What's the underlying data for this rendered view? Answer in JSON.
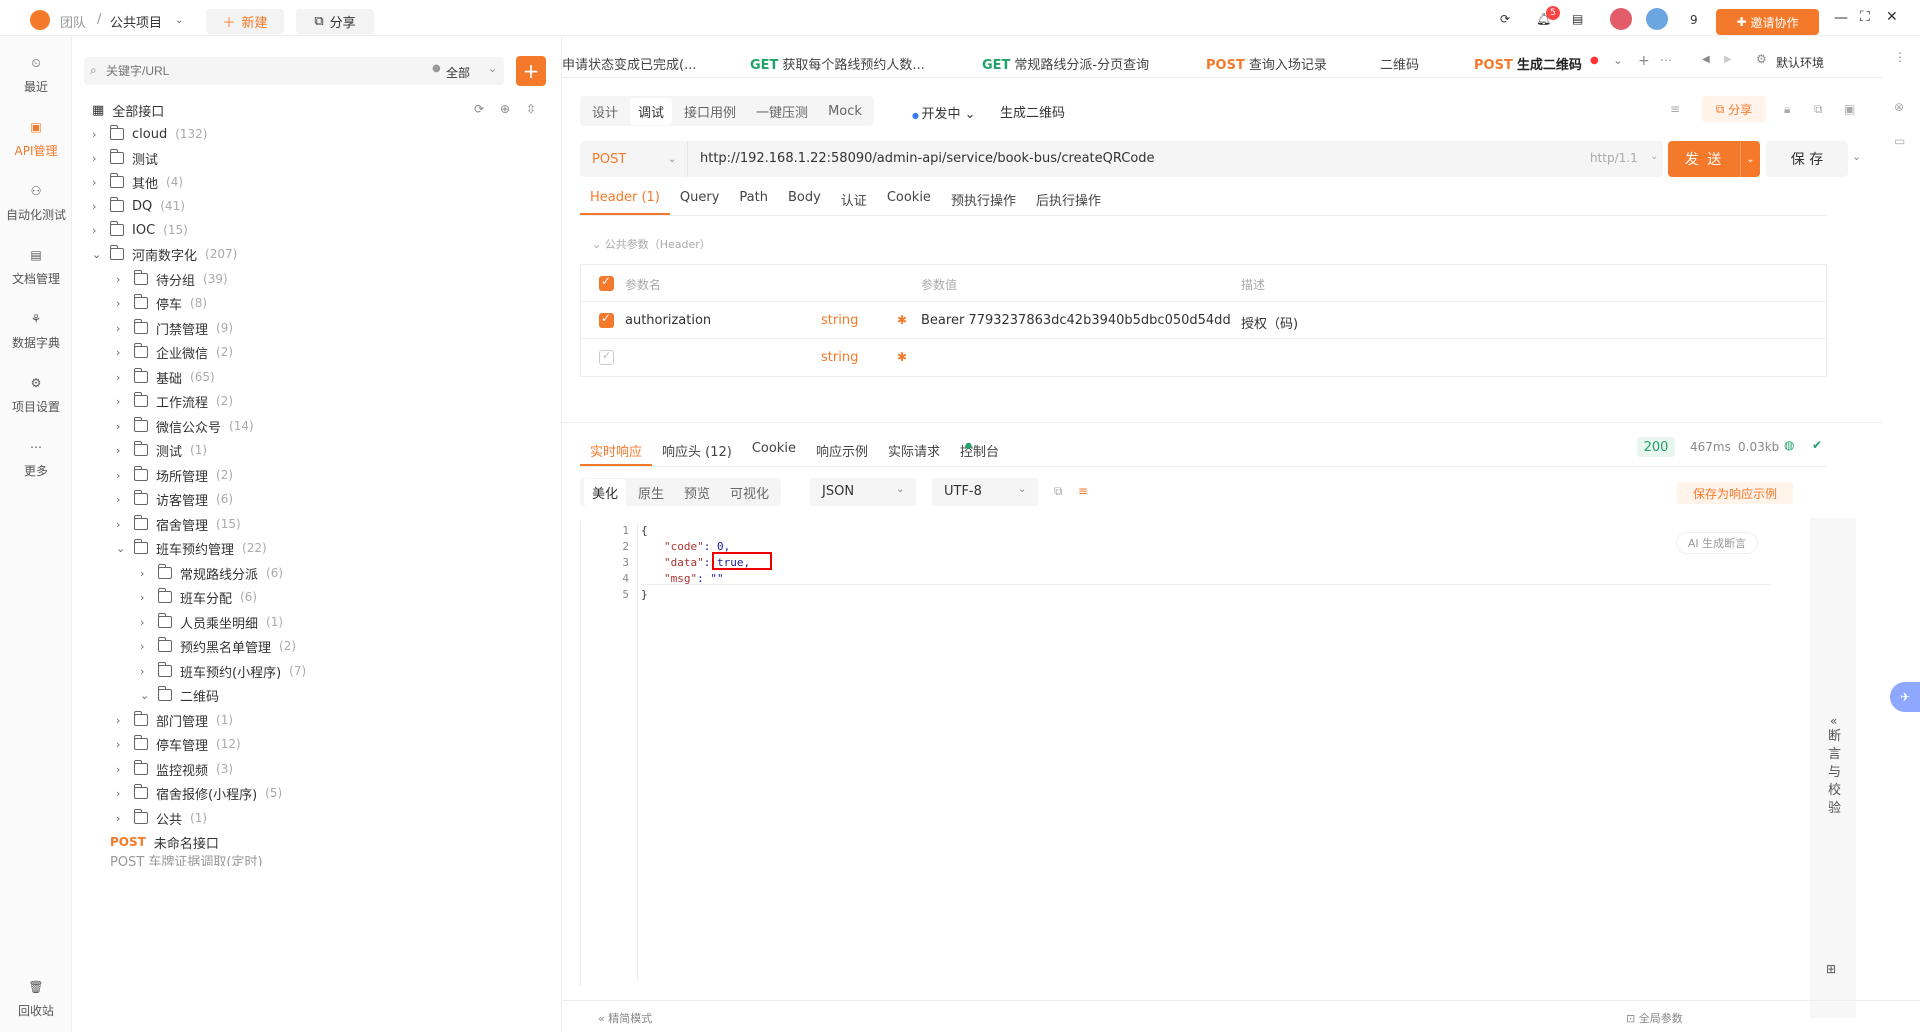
{
  "topbar": {
    "team": "团队",
    "sep": "/",
    "project": "公共项目",
    "new_label": "新建",
    "share_label": "分享",
    "notif_count": "5",
    "member_count": "9",
    "invite_label": "邀请协作"
  },
  "leftnav": {
    "items": [
      {
        "label": "最近"
      },
      {
        "label": "API管理"
      },
      {
        "label": "自动化测试"
      },
      {
        "label": "文档管理"
      },
      {
        "label": "数据字典"
      },
      {
        "label": "项目设置"
      },
      {
        "label": "更多"
      },
      {
        "label": "回收站"
      }
    ]
  },
  "tree": {
    "search_placeholder": "关键字/URL",
    "filter": "全部",
    "root": "全部接口",
    "nodes": [
      {
        "label": "cloud",
        "count": "(132)"
      },
      {
        "label": "测试",
        "count": ""
      },
      {
        "label": "其他",
        "count": "(4)"
      },
      {
        "label": "DQ",
        "count": "(41)"
      },
      {
        "label": "IOC",
        "count": "(15)"
      },
      {
        "label": "河南数字化",
        "count": "(207)"
      },
      {
        "label": "待分组",
        "count": "(39)"
      },
      {
        "label": "停车",
        "count": "(8)"
      },
      {
        "label": "门禁管理",
        "count": "(9)"
      },
      {
        "label": "企业微信",
        "count": "(2)"
      },
      {
        "label": "基础",
        "count": "(65)"
      },
      {
        "label": "工作流程",
        "count": "(2)"
      },
      {
        "label": "微信公众号",
        "count": "(14)"
      },
      {
        "label": "测试",
        "count": "(1)"
      },
      {
        "label": "场所管理",
        "count": "(2)"
      },
      {
        "label": "访客管理",
        "count": "(6)"
      },
      {
        "label": "宿舍管理",
        "count": "(15)"
      },
      {
        "label": "班车预约管理",
        "count": "(22)"
      },
      {
        "label": "常规路线分派",
        "count": "(6)"
      },
      {
        "label": "班车分配",
        "count": "(6)"
      },
      {
        "label": "人员乘坐明细",
        "count": "(1)"
      },
      {
        "label": "预约黑名单管理",
        "count": "(2)"
      },
      {
        "label": "班车预约(小程序)",
        "count": "(7)"
      },
      {
        "label": "二维码",
        "count": ""
      },
      {
        "label": "部门管理",
        "count": "(1)"
      },
      {
        "label": "停车管理",
        "count": "(12)"
      },
      {
        "label": "监控视频",
        "count": "(3)"
      },
      {
        "label": "宿舍报修(小程序)",
        "count": "(5)"
      },
      {
        "label": "公共",
        "count": "(1)"
      }
    ],
    "last_method": "POST",
    "last_label": "未命名接口",
    "clipped": "POST 车牌证据调取(定时)"
  },
  "tabs": [
    {
      "method": "",
      "label": "申请状态变成已完成(..."
    },
    {
      "method": "GET",
      "label": "获取每个路线预约人数..."
    },
    {
      "method": "GET",
      "label": "常规路线分派-分页查询"
    },
    {
      "method": "POST",
      "label": "查询入场记录"
    },
    {
      "method": "",
      "label": "二维码"
    },
    {
      "method": "POST",
      "label": "生成二维码"
    }
  ],
  "env": "默认环境",
  "mode_tabs": [
    "设计",
    "调试",
    "接口用例",
    "一键压测",
    "Mock"
  ],
  "status": "开发中",
  "api_name": "生成二维码",
  "share2": "分享",
  "request": {
    "method": "POST",
    "url": "http://192.168.1.22:58090/admin-api/service/book-bus/createQRCode",
    "protocol": "http/1.1",
    "send": "发 送",
    "save": "保 存"
  },
  "req_tabs": [
    "Header (1)",
    "Query",
    "Path",
    "Body",
    "认证",
    "Cookie",
    "预执行操作",
    "后执行操作"
  ],
  "public_params": "公共参数（Header）",
  "param_table": {
    "headers": [
      "参数名",
      "参数值",
      "描述"
    ],
    "rows": [
      {
        "name": "authorization",
        "type": "string",
        "value": "Bearer 7793237863dc42b3940b5dbc050d54dd",
        "desc": "授权（码)"
      },
      {
        "name": "",
        "type": "string",
        "value": "",
        "desc": ""
      }
    ]
  },
  "resp_tabs": [
    "实时响应",
    "响应头 (12)",
    "Cookie",
    "响应示例",
    "实际请求",
    "控制台"
  ],
  "resp_meta": {
    "status": "200",
    "time": "467ms",
    "size": "0.03kb"
  },
  "view_tabs": [
    "美化",
    "原生",
    "预览",
    "可视化"
  ],
  "format": "JSON",
  "encoding": "UTF-8",
  "save_example": "保存为响应示例",
  "ai_assert": "AI 生成断言",
  "code_lines": [
    {
      "n": "1",
      "text": "{"
    },
    {
      "n": "2",
      "key": "\"code\"",
      "val": ": 0,"
    },
    {
      "n": "3",
      "key": "\"data\"",
      "val": ": true,"
    },
    {
      "n": "4",
      "key": "\"msg\"",
      "val": ": \"\""
    },
    {
      "n": "5",
      "text": "}"
    }
  ],
  "side_panel": "断言与校验",
  "footer": {
    "left": "精简模式",
    "right": "全局参数"
  }
}
